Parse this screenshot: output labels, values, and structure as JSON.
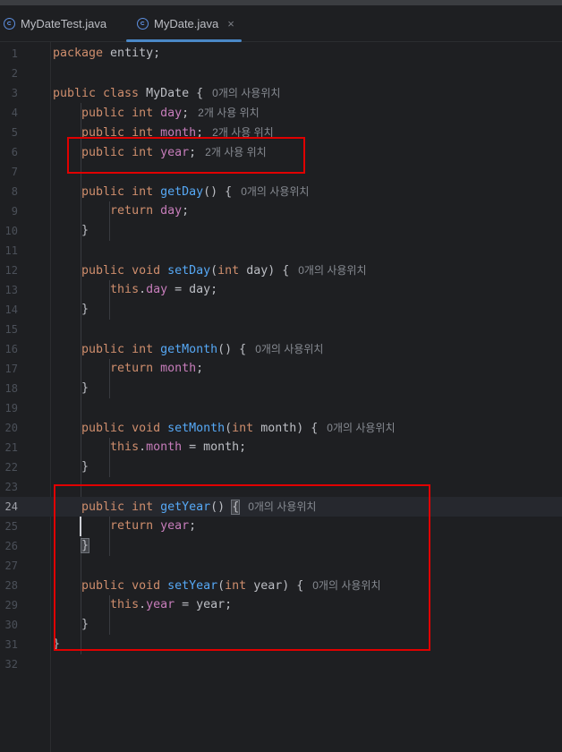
{
  "tabs": [
    {
      "label": "MyDateTest.java",
      "icon": "java-class-icon",
      "active": false
    },
    {
      "label": "MyDate.java",
      "icon": "java-class-icon",
      "active": true,
      "close": "×"
    }
  ],
  "editor": {
    "current_line": 24,
    "lines": [
      {
        "n": "1",
        "tokens": [
          [
            "kw",
            "package"
          ],
          [
            "t",
            " entity;"
          ]
        ]
      },
      {
        "n": "2",
        "tokens": []
      },
      {
        "n": "3",
        "tokens": [
          [
            "kw",
            "public class"
          ],
          [
            "t",
            " "
          ],
          [
            "cls",
            "MyDate"
          ],
          [
            "t",
            " {"
          ],
          [
            "hint",
            "0개의 사용위치"
          ]
        ]
      },
      {
        "n": "4",
        "tokens": [
          [
            "t",
            "    "
          ],
          [
            "kw",
            "public int"
          ],
          [
            "t",
            " "
          ],
          [
            "fld",
            "day"
          ],
          [
            "t",
            ";"
          ],
          [
            "hint",
            "2개 사용 위치"
          ]
        ]
      },
      {
        "n": "5",
        "tokens": [
          [
            "t",
            "    "
          ],
          [
            "kw",
            "public int"
          ],
          [
            "t",
            " "
          ],
          [
            "fld",
            "month"
          ],
          [
            "t",
            ";"
          ],
          [
            "hint",
            "2개 사용 위치"
          ]
        ]
      },
      {
        "n": "6",
        "tokens": [
          [
            "t",
            "    "
          ],
          [
            "kw",
            "public int"
          ],
          [
            "t",
            " "
          ],
          [
            "fld",
            "year"
          ],
          [
            "t",
            ";"
          ],
          [
            "hint",
            "2개 사용 위치"
          ]
        ]
      },
      {
        "n": "7",
        "tokens": []
      },
      {
        "n": "8",
        "tokens": [
          [
            "t",
            "    "
          ],
          [
            "kw",
            "public int"
          ],
          [
            "t",
            " "
          ],
          [
            "fn",
            "getDay"
          ],
          [
            "t",
            "() {"
          ],
          [
            "hint",
            "0개의 사용위치"
          ]
        ]
      },
      {
        "n": "9",
        "tokens": [
          [
            "t",
            "        "
          ],
          [
            "kw",
            "return"
          ],
          [
            "t",
            " "
          ],
          [
            "fld",
            "day"
          ],
          [
            "t",
            ";"
          ]
        ]
      },
      {
        "n": "10",
        "tokens": [
          [
            "t",
            "    }"
          ]
        ]
      },
      {
        "n": "11",
        "tokens": []
      },
      {
        "n": "12",
        "tokens": [
          [
            "t",
            "    "
          ],
          [
            "kw",
            "public void"
          ],
          [
            "t",
            " "
          ],
          [
            "fn",
            "setDay"
          ],
          [
            "t",
            "("
          ],
          [
            "kw",
            "int"
          ],
          [
            "t",
            " day) {"
          ],
          [
            "hint",
            "0개의 사용위치"
          ]
        ]
      },
      {
        "n": "13",
        "tokens": [
          [
            "t",
            "        "
          ],
          [
            "kw",
            "this"
          ],
          [
            "t",
            "."
          ],
          [
            "fld",
            "day"
          ],
          [
            "t",
            " = day;"
          ]
        ]
      },
      {
        "n": "14",
        "tokens": [
          [
            "t",
            "    }"
          ]
        ]
      },
      {
        "n": "15",
        "tokens": []
      },
      {
        "n": "16",
        "tokens": [
          [
            "t",
            "    "
          ],
          [
            "kw",
            "public int"
          ],
          [
            "t",
            " "
          ],
          [
            "fn",
            "getMonth"
          ],
          [
            "t",
            "() {"
          ],
          [
            "hint",
            "0개의 사용위치"
          ]
        ]
      },
      {
        "n": "17",
        "tokens": [
          [
            "t",
            "        "
          ],
          [
            "kw",
            "return"
          ],
          [
            "t",
            " "
          ],
          [
            "fld",
            "month"
          ],
          [
            "t",
            ";"
          ]
        ]
      },
      {
        "n": "18",
        "tokens": [
          [
            "t",
            "    }"
          ]
        ]
      },
      {
        "n": "19",
        "tokens": []
      },
      {
        "n": "20",
        "tokens": [
          [
            "t",
            "    "
          ],
          [
            "kw",
            "public void"
          ],
          [
            "t",
            " "
          ],
          [
            "fn",
            "setMonth"
          ],
          [
            "t",
            "("
          ],
          [
            "kw",
            "int"
          ],
          [
            "t",
            " month) {"
          ],
          [
            "hint",
            "0개의 사용위치"
          ]
        ]
      },
      {
        "n": "21",
        "tokens": [
          [
            "t",
            "        "
          ],
          [
            "kw",
            "this"
          ],
          [
            "t",
            "."
          ],
          [
            "fld",
            "month"
          ],
          [
            "t",
            " = month;"
          ]
        ]
      },
      {
        "n": "22",
        "tokens": [
          [
            "t",
            "    }"
          ]
        ]
      },
      {
        "n": "23",
        "tokens": []
      },
      {
        "n": "24",
        "tokens": [
          [
            "t",
            "    "
          ],
          [
            "kw",
            "public int"
          ],
          [
            "t",
            " "
          ],
          [
            "fn",
            "getYear"
          ],
          [
            "t",
            "() "
          ],
          [
            "bh",
            "{"
          ],
          [
            "hint",
            "0개의 사용위치"
          ]
        ]
      },
      {
        "n": "25",
        "tokens": [
          [
            "t",
            "        "
          ],
          [
            "kw",
            "return"
          ],
          [
            "t",
            " "
          ],
          [
            "fld",
            "year"
          ],
          [
            "t",
            ";"
          ]
        ]
      },
      {
        "n": "26",
        "tokens": [
          [
            "t",
            "    "
          ],
          [
            "bh",
            "}"
          ]
        ]
      },
      {
        "n": "27",
        "tokens": []
      },
      {
        "n": "28",
        "tokens": [
          [
            "t",
            "    "
          ],
          [
            "kw",
            "public void"
          ],
          [
            "t",
            " "
          ],
          [
            "fn",
            "setYear"
          ],
          [
            "t",
            "("
          ],
          [
            "kw",
            "int"
          ],
          [
            "t",
            " year) {"
          ],
          [
            "hint",
            "0개의 사용위치"
          ]
        ]
      },
      {
        "n": "29",
        "tokens": [
          [
            "t",
            "        "
          ],
          [
            "kw",
            "this"
          ],
          [
            "t",
            "."
          ],
          [
            "fld",
            "year"
          ],
          [
            "t",
            " = year;"
          ]
        ]
      },
      {
        "n": "30",
        "tokens": [
          [
            "t",
            "    }"
          ]
        ]
      },
      {
        "n": "31",
        "tokens": [
          [
            "t",
            "}"
          ]
        ]
      },
      {
        "n": "32",
        "tokens": []
      }
    ]
  },
  "colors": {
    "highlight_box": "#e00000",
    "background": "#1e1f22"
  }
}
